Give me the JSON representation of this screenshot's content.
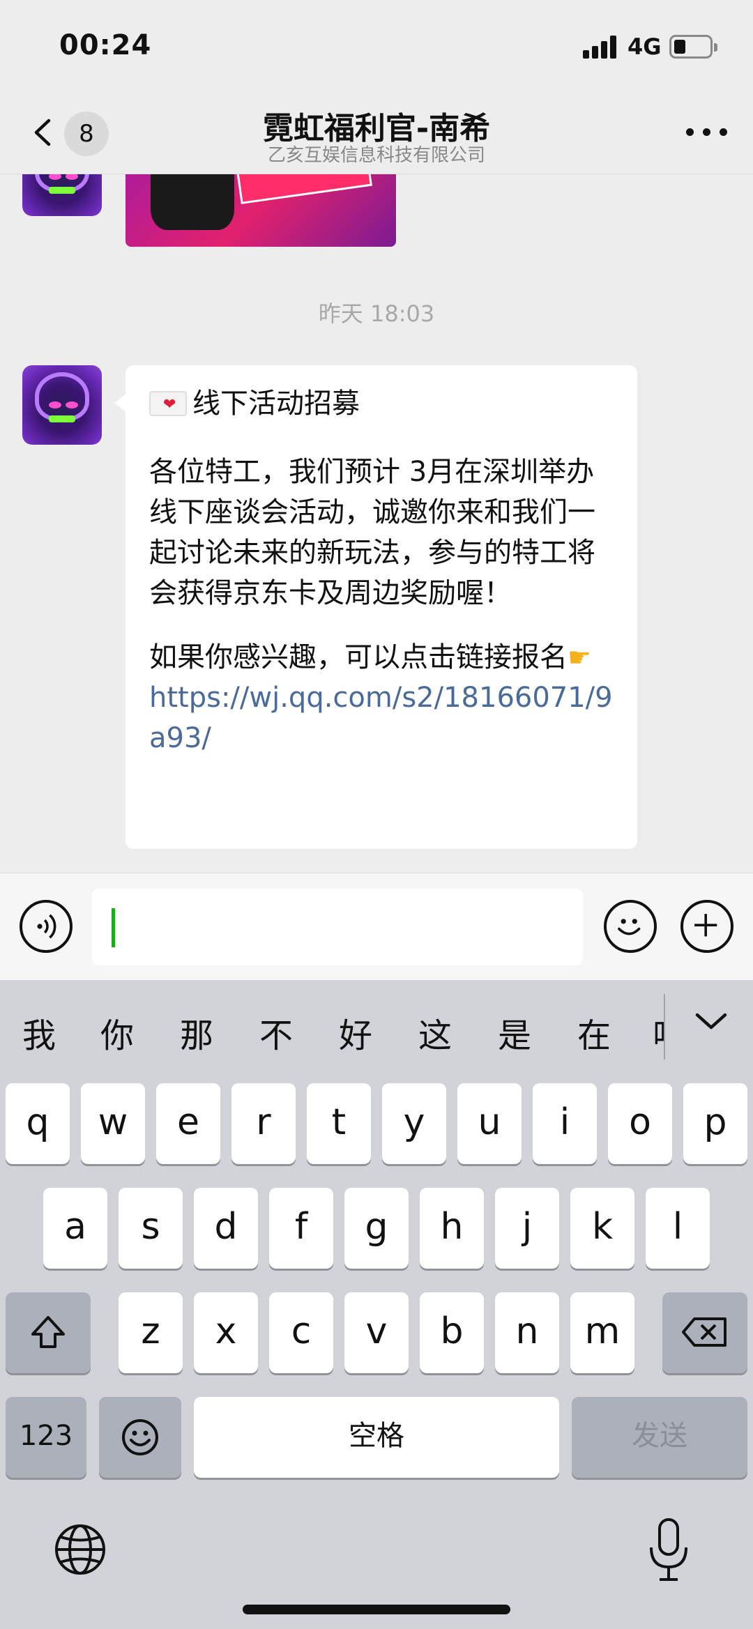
{
  "status_bar": {
    "time": "00:24",
    "network": "4G"
  },
  "nav": {
    "unread_count": "8",
    "title": "霓虹福利官-南希",
    "subtitle": "乙亥互娱信息科技有限公司"
  },
  "chat": {
    "timestamp": "昨天 18:03",
    "message": {
      "title": "线下活动招募",
      "body": "各位特工，我们预计 3月在深圳举办线下座谈会活动，诚邀你来和我们一起讨论未来的新玩法，参与的特工将会获得京东卡及周边奖励喔！",
      "cta_text": "如果你感兴趣，可以点击链接报名",
      "link": "https://wj.qq.com/s2/18166071/9a93/"
    }
  },
  "keyboard": {
    "candidates": [
      "我",
      "你",
      "那",
      "不",
      "好",
      "这",
      "是",
      "在",
      "吧"
    ],
    "row1": [
      "q",
      "w",
      "e",
      "r",
      "t",
      "y",
      "u",
      "i",
      "o",
      "p"
    ],
    "row2": [
      "a",
      "s",
      "d",
      "f",
      "g",
      "h",
      "j",
      "k",
      "l"
    ],
    "row3": [
      "z",
      "x",
      "c",
      "v",
      "b",
      "n",
      "m"
    ],
    "numbers_key": "123",
    "space_key": "空格",
    "send_key": "发送"
  },
  "icons": {
    "back": "chevron-left-icon",
    "more": "more-dots-icon",
    "voice": "voice-icon",
    "emoji": "emoji-icon",
    "plus": "plus-icon",
    "shift": "shift-icon",
    "delete": "delete-icon",
    "globe": "globe-icon",
    "mic": "microphone-icon"
  },
  "colors": {
    "link": "#4a6b9a",
    "caret": "#1aad19",
    "background": "#ededed",
    "keyboard": "#d1d3d9"
  }
}
